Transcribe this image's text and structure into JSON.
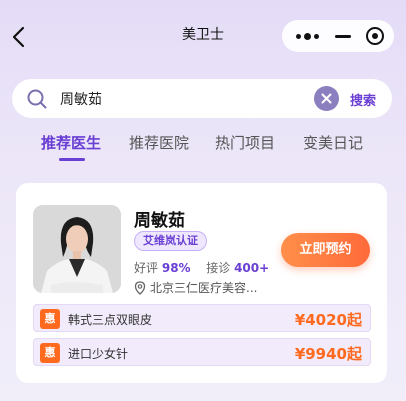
{
  "header": {
    "title": "美卫士",
    "back_icon": "chevron-left-icon",
    "menu_icon": "more-dots-icon",
    "minimize_icon": "minus-icon",
    "close_icon": "target-icon"
  },
  "search": {
    "value": "周敏茹",
    "button_label": "搜索",
    "clear_icon": "clear-icon"
  },
  "tabs": [
    {
      "label": "推荐医生",
      "active": true
    },
    {
      "label": "推荐医院",
      "active": false
    },
    {
      "label": "热门项目",
      "active": false
    },
    {
      "label": "变美日记",
      "active": false
    }
  ],
  "doctor": {
    "name": "周敏茹",
    "certification": "艾维岚认证",
    "rating_label": "好评",
    "rating_value": "98%",
    "consult_label": "接诊",
    "consult_value": "400+",
    "location": "北京三仁医疗美容...",
    "book_label": "立即预约"
  },
  "items": [
    {
      "icon_text": "惠",
      "name": "韩式三点双眼皮",
      "price": "¥4020起"
    },
    {
      "icon_text": "惠",
      "name": "进口少女针",
      "price": "¥9940起"
    }
  ],
  "colors": {
    "accent": "#6a3fd3",
    "orange": "#ff6a1f"
  }
}
